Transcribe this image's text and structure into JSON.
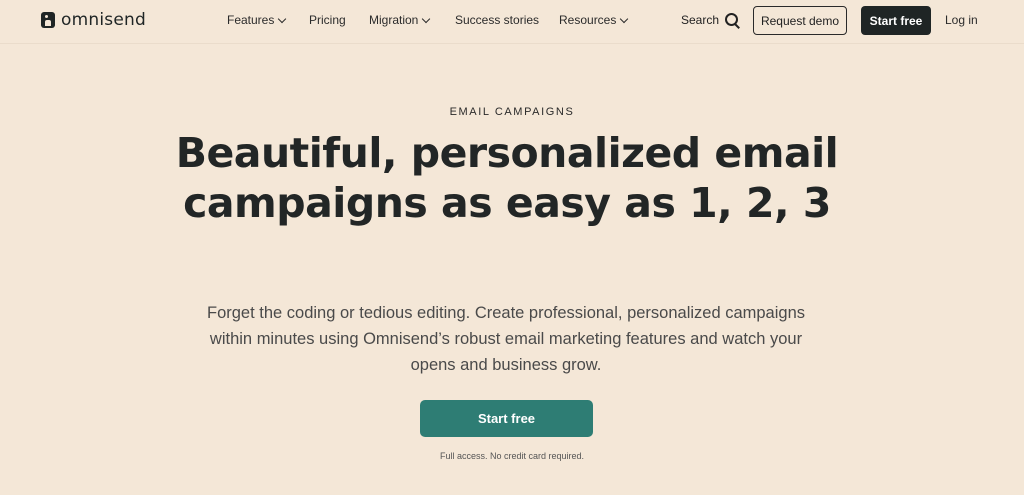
{
  "brand": {
    "name": "omnisend",
    "logo_icon": "omnisend-logo-icon"
  },
  "nav": {
    "items": [
      {
        "label": "Features",
        "dropdown": true
      },
      {
        "label": "Pricing",
        "dropdown": false
      },
      {
        "label": "Migration",
        "dropdown": true
      },
      {
        "label": "Success stories",
        "dropdown": false
      },
      {
        "label": "Resources",
        "dropdown": true
      }
    ],
    "search_label": "Search",
    "request_demo_label": "Request demo",
    "start_free_label": "Start free",
    "login_label": "Log in"
  },
  "hero": {
    "eyebrow": "EMAIL CAMPAIGNS",
    "headline": "Beautiful, personalized email campaigns as easy as 1, 2, 3",
    "description": "Forget the coding or tedious editing. Create professional, personalized campaigns within minutes using Omnisend’s robust email marketing features and watch your opens and business grow.",
    "cta_label": "Start free",
    "note": "Full access. No credit card required."
  },
  "colors": {
    "background": "#f4e7d7",
    "primary_dark": "#1f2525",
    "cta_teal": "#2e7d74"
  }
}
